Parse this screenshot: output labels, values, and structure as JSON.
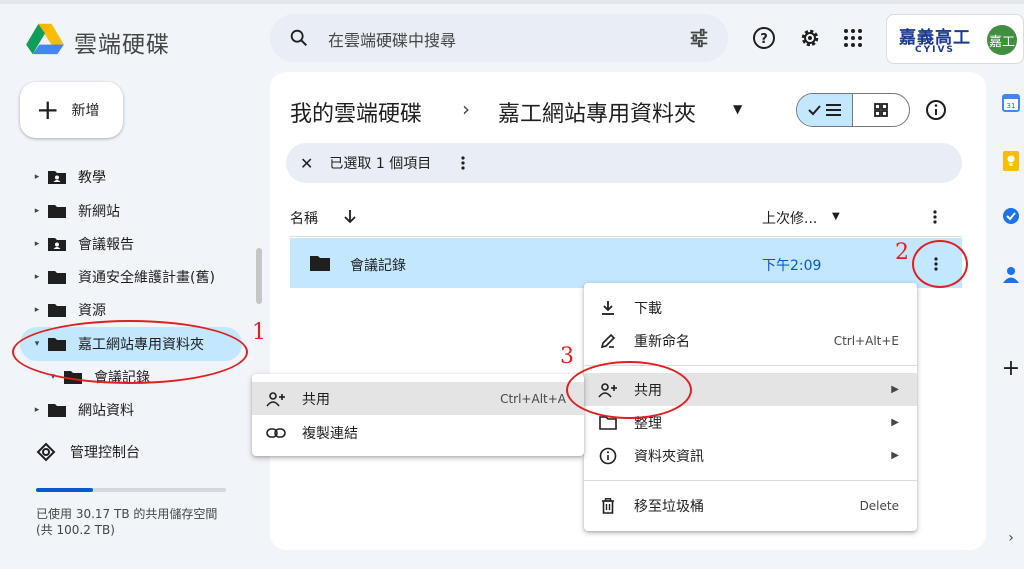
{
  "app": {
    "title": "雲端硬碟"
  },
  "search": {
    "placeholder": "在雲端硬碟中搜尋"
  },
  "account": {
    "badge_title": "嘉義高工",
    "badge_subtitle": "CYIVS",
    "avatar_text": "嘉工"
  },
  "sidebar": {
    "new_label": "新增",
    "tree": [
      {
        "label": "教學",
        "icon": "shared-folder-icon"
      },
      {
        "label": "新網站",
        "icon": "folder-icon"
      },
      {
        "label": "會議報告",
        "icon": "shared-folder-icon"
      },
      {
        "label": "資通安全維護計畫(舊)",
        "icon": "folder-icon"
      },
      {
        "label": "資源",
        "icon": "folder-icon"
      },
      {
        "label": "嘉工網站專用資料夾",
        "icon": "folder-icon",
        "selected": true,
        "expanded": true
      },
      {
        "label": "會議記錄",
        "icon": "folder-icon",
        "child": true,
        "expanded": true
      },
      {
        "label": "網站資料",
        "icon": "folder-icon"
      }
    ],
    "admin_label": "管理控制台",
    "storage_text": "已使用 30.17 TB 的共用儲存空間 (共 100.2 TB)",
    "storage_used_fraction": 0.301
  },
  "breadcrumb": {
    "root": "我的雲端硬碟",
    "separator": "›",
    "current": "嘉工網站專用資料夾"
  },
  "selection_bar": {
    "text": "已選取 1 個項目"
  },
  "table": {
    "col_name": "名稱",
    "col_modified": "上次修...",
    "rows": [
      {
        "name": "會議記錄",
        "modified": "下午2:09"
      }
    ]
  },
  "context_menu": {
    "download": "下載",
    "rename": "重新命名",
    "rename_shortcut": "Ctrl+Alt+E",
    "share": "共用",
    "organize": "整理",
    "folder_info": "資料夾資訊",
    "trash": "移至垃圾桶",
    "trash_shortcut": "Delete"
  },
  "share_submenu": {
    "share": "共用",
    "share_shortcut": "Ctrl+Alt+A",
    "copy_link": "複製連結"
  },
  "annotations": {
    "n1": "1",
    "n2": "2",
    "n3": "3"
  },
  "colors": {
    "accent": "#0b57d0",
    "selected_bg": "#c2e7ff",
    "annotation": "#e02020"
  }
}
